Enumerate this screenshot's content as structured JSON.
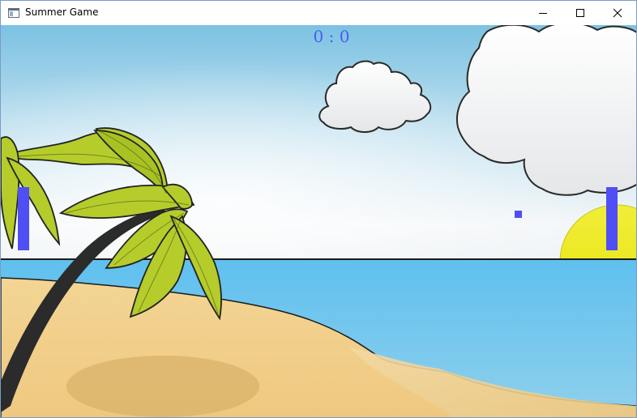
{
  "window": {
    "title": "Summer Game",
    "icon": "app-window-icon",
    "controls": [
      "minimize-icon",
      "maximize-icon",
      "close-icon"
    ]
  },
  "game": {
    "score": {
      "left": 0,
      "right": 0,
      "display": "0 : 0"
    },
    "colors": {
      "paddle": "#4f4ff5",
      "ball": "#4f4ff5",
      "score": "#4a5ef0",
      "sky_top": "#7ec3e3",
      "sky_mid": "#f2f6f8",
      "sea": "#66c3ee",
      "sand": "#f1cf8a",
      "sun": "#ebe716",
      "palm_leaf": "#b5cc2b"
    }
  }
}
